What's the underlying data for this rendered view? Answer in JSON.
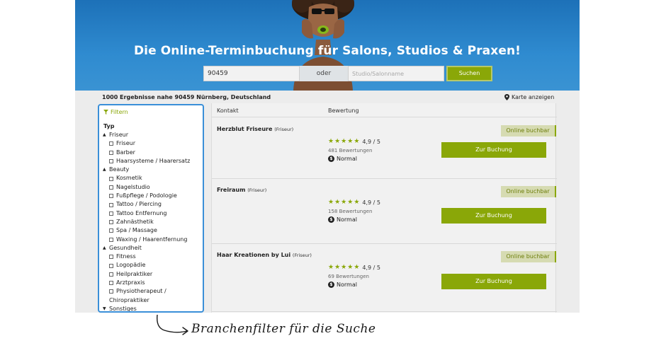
{
  "hero": {
    "title": "Die Online-Terminbuchung für Salons, Studios & Praxen!",
    "background_color": "#1d71b8"
  },
  "search": {
    "zip_value": "90459",
    "or_label": "oder",
    "studio_placeholder": "Studio/Salonname",
    "button_label": "Suchen",
    "button_color": "#8aa708"
  },
  "results_header": {
    "count_text": "1000 Ergebnisse nahe 90459 Nürnberg, Deutschland",
    "map_link": "Karte anzeigen",
    "map_icon": "map-pin-icon"
  },
  "filter": {
    "header_label": "Filtern",
    "header_icon": "funnel-icon",
    "type_heading": "Typ",
    "accent_color": "#3a8fd8",
    "groups": [
      {
        "label": "Friseur",
        "expanded": true,
        "options": [
          "Friseur",
          "Barber",
          "Haarsysteme / Haarersatz"
        ]
      },
      {
        "label": "Beauty",
        "expanded": true,
        "options": [
          "Kosmetik",
          "Nagelstudio",
          "Fußpflege / Podologie",
          "Tattoo / Piercing",
          "Tattoo Entfernung",
          "Zahnästhetik",
          "Spa / Massage",
          "Waxing / Haarentfernung"
        ]
      },
      {
        "label": "Gesundheit",
        "expanded": true,
        "options": [
          "Fitness",
          "Logopädie",
          "Heilpraktiker",
          "Arztpraxis",
          "Physiotherapeut /"
        ],
        "continuation": "Chiropraktiker"
      },
      {
        "label": "Sonstiges",
        "expanded": false,
        "options": []
      }
    ]
  },
  "table": {
    "col_contact": "Kontakt",
    "col_rating": "Bewertung"
  },
  "listings": [
    {
      "name": "Herzblut Friseure",
      "category": "(Friseur)",
      "badge": "Online buchbar",
      "score": "4,9 / 5",
      "stars": 5,
      "reviews": "481 Bewertungen",
      "price_symbol": "$",
      "price_label": "Normal",
      "book_label": "Zur Buchung"
    },
    {
      "name": "Freiraum",
      "category": "(Friseur)",
      "badge": "Online buchbar",
      "score": "4,9 / 5",
      "stars": 5,
      "reviews": "158 Bewertungen",
      "price_symbol": "$",
      "price_label": "Normal",
      "book_label": "Zur Buchung"
    },
    {
      "name": "Haar Kreationen by Lui",
      "category": "(Friseur)",
      "badge": "Online buchbar",
      "score": "4,9 / 5",
      "stars": 5,
      "reviews": "69 Bewertungen",
      "price_symbol": "$",
      "price_label": "Normal",
      "book_label": "Zur Buchung"
    }
  ],
  "annotation": {
    "text": "Branchenfilter für die Suche",
    "icon": "curved-arrow-icon"
  }
}
